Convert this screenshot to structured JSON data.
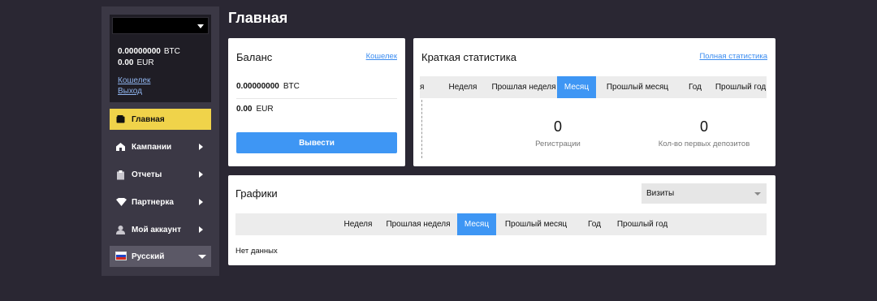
{
  "page_title": "Главная",
  "sidebar": {
    "account": {
      "btc_amount": "0.00000000",
      "btc_currency": "BTC",
      "eur_amount": "0.00",
      "eur_currency": "EUR",
      "wallet_link": "Кошелек",
      "logout_link": "Выход"
    },
    "items": [
      {
        "label": "Главная",
        "icon": "wallet-icon",
        "active": true
      },
      {
        "label": "Кампании",
        "icon": "home-icon"
      },
      {
        "label": "Отчеты",
        "icon": "clipboard-icon"
      },
      {
        "label": "Партнерка",
        "icon": "diamond-icon"
      },
      {
        "label": "Мой аккаунт",
        "icon": "user-icon"
      }
    ],
    "language": "Русский"
  },
  "balance": {
    "title": "Баланс",
    "wallet_link": "Кошелек",
    "btc_amount": "0.00000000",
    "btc_currency": "BTC",
    "eur_amount": "0.00",
    "eur_currency": "EUR",
    "withdraw_button": "Вывести"
  },
  "stats": {
    "title": "Краткая статистика",
    "full_link": "Полная статистика",
    "tabs": [
      "я",
      "Неделя",
      "Прошлая неделя",
      "Месяц",
      "Прошлый месяц",
      "Год",
      "Прошлый год"
    ],
    "active_tab": "Месяц",
    "items": [
      {
        "value": "0",
        "label": "Регистрации"
      },
      {
        "value": "0",
        "label": "Кол-во первых депозитов"
      }
    ]
  },
  "charts": {
    "title": "Графики",
    "select_value": "Визиты",
    "tabs": [
      "Неделя",
      "Прошлая неделя",
      "Месяц",
      "Прошлый месяц",
      "Год",
      "Прошлый год"
    ],
    "active_tab": "Месяц",
    "empty_text": "Нет данных"
  },
  "colors": {
    "background": "#2a2733",
    "sidebar": "#3b3845",
    "active_nav": "#f0d34a",
    "accent": "#3e96f4"
  }
}
